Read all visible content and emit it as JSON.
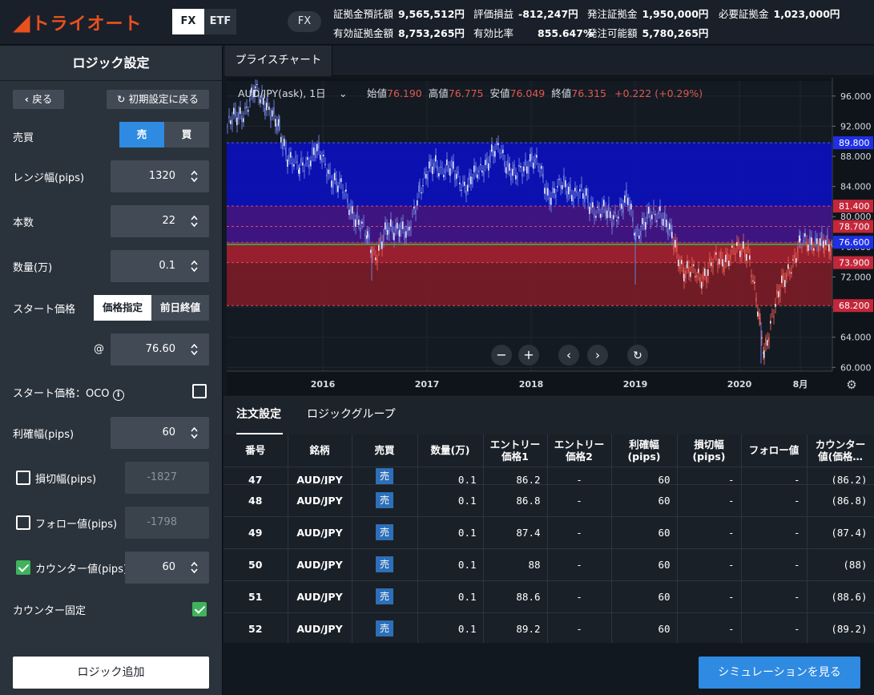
{
  "app": {
    "logo_text": "トライオート",
    "logo_mark": "◢"
  },
  "header": {
    "product_tabs": [
      {
        "label": "FX",
        "active": true
      },
      {
        "label": "ETF",
        "active": false
      }
    ],
    "market_pill": "FX",
    "account": {
      "deposit_label": "証拠金預託額",
      "deposit_value": "9,565,512円",
      "pl_label": "評価損益",
      "pl_value": "-812,247円",
      "margin_label": "発注証拠金",
      "margin_value": "1,950,000円",
      "required_label": "必要証拠金",
      "required_value": "1,023,000円",
      "effective_label": "有効証拠金額",
      "effective_value": "8,753,265円",
      "ratio_label": "有効比率",
      "ratio_value": "855.647%",
      "available_label": "発注可能額",
      "available_value": "5,780,265円"
    }
  },
  "logic": {
    "title": "ロジック設定",
    "back_label": "戻る",
    "reset_label": "初期設定に戻る",
    "side_label": "売買",
    "side_sell": "売",
    "side_buy": "買",
    "range_label": "レンジ幅(pips)",
    "range_value": "1320",
    "count_label": "本数",
    "count_value": "22",
    "qty_label": "数量(万)",
    "qty_value": "0.1",
    "start_label": "スタート価格",
    "start_price_btn": "価格指定",
    "start_prev_btn": "前日終値",
    "at_label": "@",
    "start_value": "76.60",
    "oco_label": "スタート価格：OCO",
    "tp_label": "利確幅(pips)",
    "tp_value": "60",
    "sl_label": "損切幅(pips)",
    "sl_value": "-1827",
    "follow_label": "フォロー値(pips)",
    "follow_value": "-1798",
    "counter_label": "カウンター値(pips)",
    "counter_value": "60",
    "counter_fixed_label": "カウンター固定",
    "add_label": "ロジック追加"
  },
  "chart": {
    "tab_label": "プライスチャート",
    "symbol": "AUD/JPY(ask), 1日",
    "open_label": "始値",
    "open": "76.190",
    "high_label": "高値",
    "high": "76.775",
    "low_label": "安値",
    "low": "76.049",
    "close_label": "終値",
    "close": "76.315",
    "change": "+0.222 (+0.29%)",
    "y_ticks": [
      96.0,
      92.0,
      88.0,
      84.0,
      80.0,
      76.0,
      72.0,
      68.0,
      64.0,
      60.0
    ],
    "y_tick_labels": [
      "96.000",
      "92.000",
      "88.000",
      "84.000",
      "80.000",
      "76.000",
      "72.000",
      "68.000",
      "64.000",
      "60.000"
    ],
    "x_ticks": [
      "2016",
      "2017",
      "2018",
      "2019",
      "2020",
      "8月"
    ],
    "price_tags": [
      {
        "value": 89.8,
        "label": "89.800",
        "color": "#1f2fe6"
      },
      {
        "value": 81.4,
        "label": "81.400",
        "color": "#c4263a"
      },
      {
        "value": 78.7,
        "label": "78.700",
        "color": "#c4263a"
      },
      {
        "value": 76.6,
        "label": "76.600",
        "color": "#1f2fe6"
      },
      {
        "value": 73.9,
        "label": "73.900",
        "color": "#c4263a"
      },
      {
        "value": 68.2,
        "label": "68.200",
        "color": "#c4263a"
      }
    ],
    "ylim": [
      59.5,
      98.0
    ],
    "colors": {
      "sell_zone": "#0a0fc8",
      "buy_zone": "#8a1b28",
      "candle": "#6b7bd8",
      "candle_red": "#e0584f"
    }
  },
  "orders": {
    "tab_settings": "注文設定",
    "tab_group": "ロジックグループ",
    "columns": [
      "番号",
      "銘柄",
      "売買",
      "数量(万)",
      "エントリー\n価格1",
      "エントリー\n価格2",
      "利確幅\n(pips)",
      "損切幅\n(pips)",
      "フォロー値",
      "カウンター\n値(価格…"
    ],
    "rows": [
      {
        "no": "47",
        "sym": "AUD/JPY",
        "side": "売",
        "qty": "0.1",
        "e1": "86.2",
        "e2": "-",
        "tp": "60",
        "sl": "-",
        "fw": "-",
        "ct": "(86.2)"
      },
      {
        "no": "48",
        "sym": "AUD/JPY",
        "side": "売",
        "qty": "0.1",
        "e1": "86.8",
        "e2": "-",
        "tp": "60",
        "sl": "-",
        "fw": "-",
        "ct": "(86.8)"
      },
      {
        "no": "49",
        "sym": "AUD/JPY",
        "side": "売",
        "qty": "0.1",
        "e1": "87.4",
        "e2": "-",
        "tp": "60",
        "sl": "-",
        "fw": "-",
        "ct": "(87.4)"
      },
      {
        "no": "50",
        "sym": "AUD/JPY",
        "side": "売",
        "qty": "0.1",
        "e1": "88",
        "e2": "-",
        "tp": "60",
        "sl": "-",
        "fw": "-",
        "ct": "(88)"
      },
      {
        "no": "51",
        "sym": "AUD/JPY",
        "side": "売",
        "qty": "0.1",
        "e1": "88.6",
        "e2": "-",
        "tp": "60",
        "sl": "-",
        "fw": "-",
        "ct": "(88.6)"
      },
      {
        "no": "52",
        "sym": "AUD/JPY",
        "side": "売",
        "qty": "0.1",
        "e1": "89.2",
        "e2": "-",
        "tp": "60",
        "sl": "-",
        "fw": "-",
        "ct": "(89.2)"
      }
    ]
  },
  "simulation_label": "シミュレーションを見る"
}
